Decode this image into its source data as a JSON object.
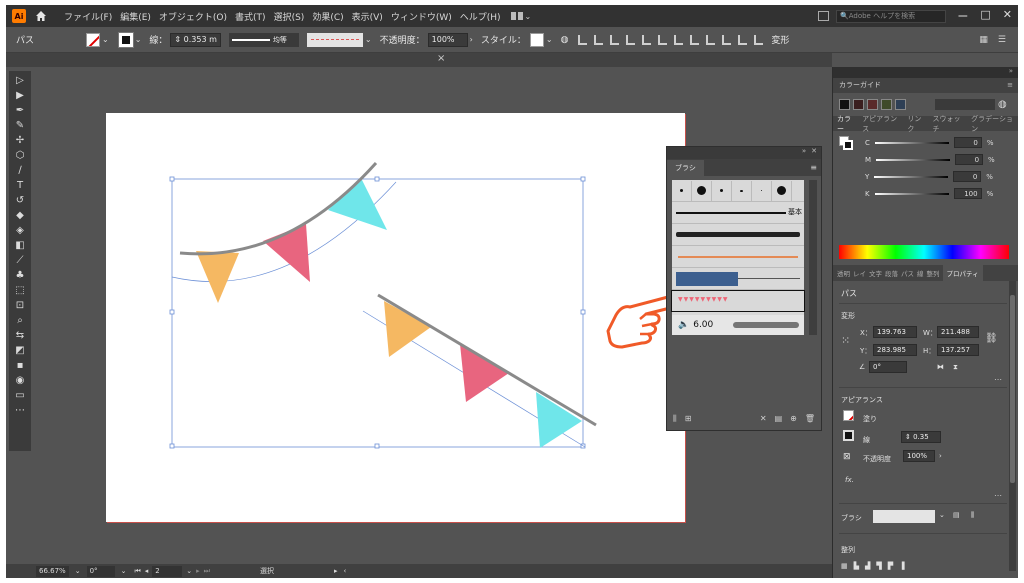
{
  "app": {
    "logo": "Ai",
    "menu": [
      "ファイル(F)",
      "編集(E)",
      "オブジェクト(O)",
      "書式(T)",
      "選択(S)",
      "効果(C)",
      "表示(V)",
      "ウィンドウ(W)",
      "ヘルプ(H)"
    ],
    "help_search_placeholder": "Adobe ヘルプを検索",
    "win_controls": [
      "ー",
      "□",
      "✕"
    ]
  },
  "control_bar": {
    "object_type": "パス",
    "stroke_label": "線：",
    "stroke_weight": "0.353 m",
    "line_profile": "均等",
    "opacity_label": "不透明度：",
    "opacity_value": "100%",
    "style_label": "スタイル：",
    "transform_label": "変形"
  },
  "document": {
    "close": "×"
  },
  "brushes_panel": {
    "tab": "ブラシ",
    "basic_label": "基本",
    "brush_size": "6.00",
    "flags_text": "▼▼▼▼▼▼▼▼▼"
  },
  "right_panel": {
    "color_guide_title": "カラーガイド",
    "color_tabs": [
      "カラー",
      "アピアランス",
      "リンク",
      "スウォッチ",
      "グラデーション"
    ],
    "cmyk": [
      {
        "channel": "C",
        "value": "0"
      },
      {
        "channel": "M",
        "value": "0"
      },
      {
        "channel": "Y",
        "value": "0"
      },
      {
        "channel": "K",
        "value": "100"
      }
    ],
    "percent": "%",
    "prop_tabs": [
      "透明",
      "レイ",
      "文字",
      "段落",
      "パス",
      "線",
      "整列",
      "プロパティ"
    ],
    "properties": {
      "object": "パス",
      "transform": "変形",
      "x_label": "X：",
      "x": "139.763",
      "y_label": "Y：",
      "y": "283.985",
      "w_label": "W：",
      "w": "211.488",
      "h_label": "H：",
      "h": "137.257",
      "angle": "0°",
      "appearance": "アピアランス",
      "fill_label": "塗り",
      "stroke_label": "線",
      "stroke_value": "0.35",
      "opacity_label": "不透明度",
      "opacity_value": "100%",
      "fx": "fx.",
      "brush_label": "ブラシ",
      "align_label": "整列"
    }
  },
  "status_bar": {
    "zoom": "66.67%",
    "rotation": "0°",
    "artboard": "2",
    "mode": "選択"
  },
  "colors": {
    "bunting_orange": "#f5b862",
    "bunting_pink": "#e8657f",
    "bunting_cyan": "#6fe6ea",
    "selection_blue": "#6b8fd6",
    "pointer_orange": "#f05a28"
  }
}
